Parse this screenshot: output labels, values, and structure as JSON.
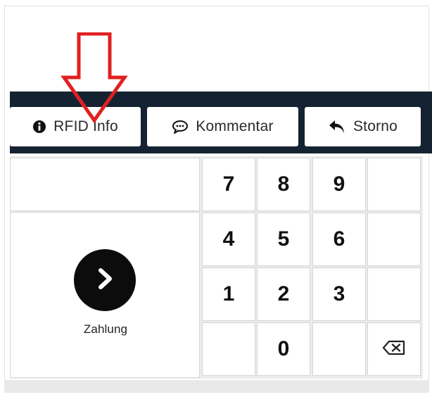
{
  "toolbar": {
    "rfid_label": "RFID Info",
    "comment_label": "Kommentar",
    "storno_label": "Storno"
  },
  "payment": {
    "label": "Zahlung"
  },
  "keypad": {
    "keys": [
      "7",
      "8",
      "9",
      "4",
      "5",
      "6",
      "1",
      "2",
      "3",
      "0"
    ]
  },
  "colors": {
    "toolbar_band": "#152231",
    "annotation_arrow": "#e02020",
    "pay_button": "#0c0c0c"
  },
  "icons": {
    "rfid": "info-circle-icon",
    "comment": "comment-bubble-icon",
    "storno": "undo-arrow-icon",
    "payment": "chevron-right-icon",
    "backspace": "backspace-icon"
  }
}
